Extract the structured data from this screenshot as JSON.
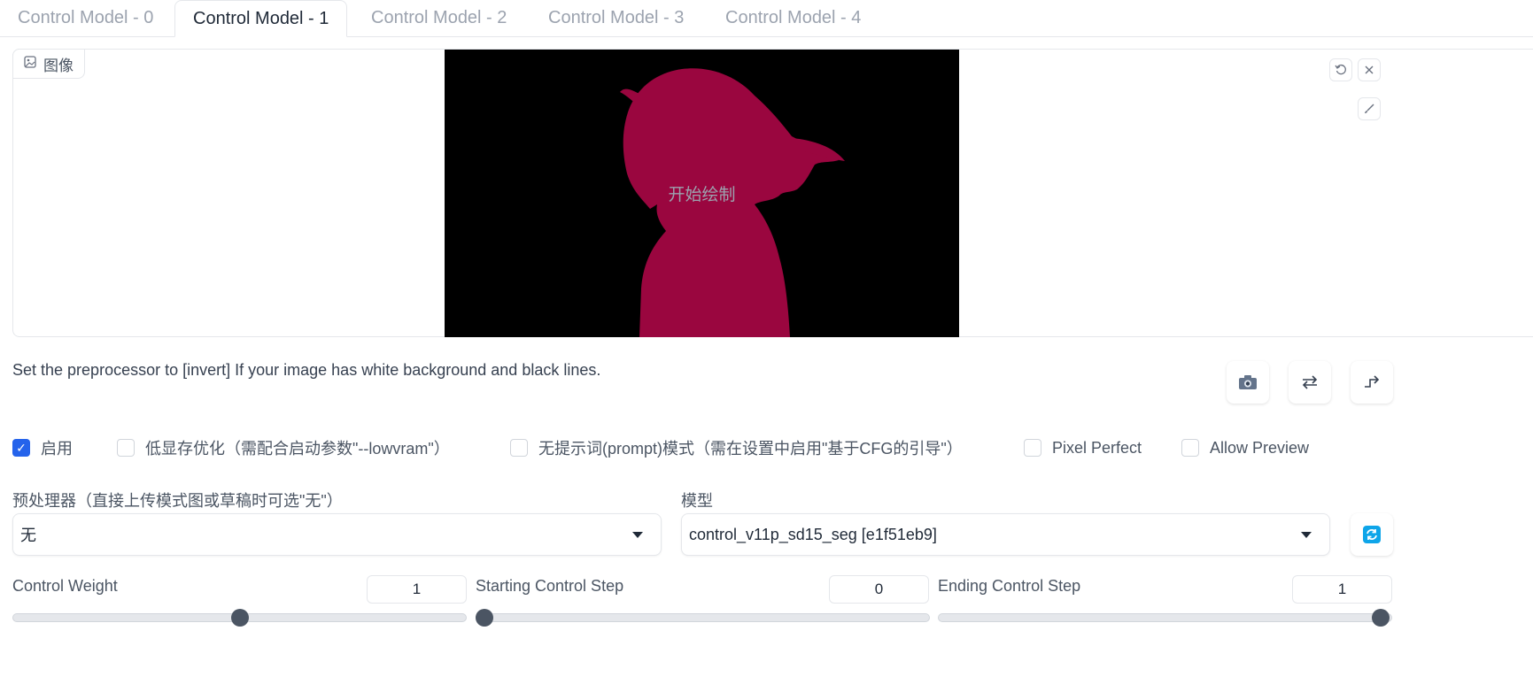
{
  "tabs": [
    {
      "label": "Control Model - 0"
    },
    {
      "label": "Control Model - 1"
    },
    {
      "label": "Control Model - 2"
    },
    {
      "label": "Control Model - 3"
    },
    {
      "label": "Control Model - 4"
    }
  ],
  "active_tab": 1,
  "image_panel": {
    "label": "图像",
    "overlay_text": "开始绘制",
    "icons": [
      "undo-icon",
      "close-icon",
      "brush-icon"
    ]
  },
  "hint_text": "Set the preprocessor to [invert] If your image has white background and black lines.",
  "tool_icons": [
    "camera-icon",
    "swap-icon",
    "send-dimensions-icon"
  ],
  "checkboxes": {
    "enable": {
      "label": "启用",
      "checked": true
    },
    "lowvram": {
      "label": "低显存优化（需配合启动参数\"--lowvram\"）",
      "checked": false
    },
    "guess_mode": {
      "label": "无提示词(prompt)模式（需在设置中启用\"基于CFG的引导\"）",
      "checked": false
    },
    "pixel_perfect": {
      "label": "Pixel Perfect",
      "checked": false
    },
    "allow_preview": {
      "label": "Allow Preview",
      "checked": false
    }
  },
  "preprocessor": {
    "label": "预处理器（直接上传模式图或草稿时可选\"无\"）",
    "value": "无"
  },
  "model": {
    "label": "模型",
    "value": "control_v11p_sd15_seg [e1f51eb9]"
  },
  "sliders": {
    "weight": {
      "label": "Control Weight",
      "value": "1",
      "fraction": 0.5
    },
    "start": {
      "label": "Starting Control Step",
      "value": "0",
      "fraction": 0.0
    },
    "end": {
      "label": "Ending Control Step",
      "value": "1",
      "fraction": 1.0
    }
  },
  "colors": {
    "accent": "#2563eb",
    "silhouette": "#9a063f",
    "refresh": "#0ea5e9"
  }
}
